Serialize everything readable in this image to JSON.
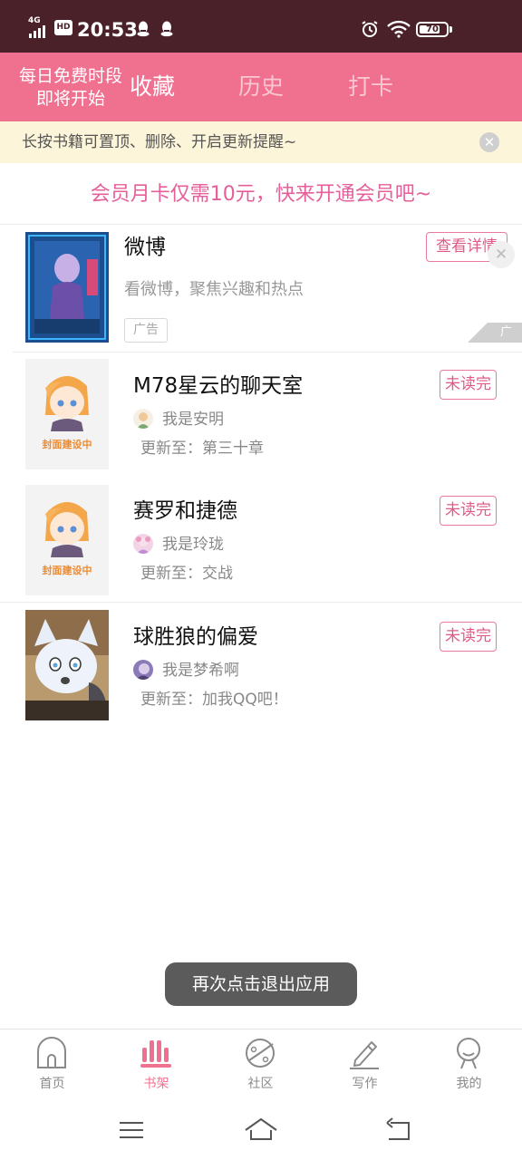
{
  "status_bar": {
    "network": "4G",
    "hd": "HD",
    "time": "20:53",
    "battery": "70"
  },
  "header": {
    "free_time_line1": "每日免费时段",
    "free_time_line2": "即将开始",
    "tabs": [
      {
        "label": "收藏",
        "active": true
      },
      {
        "label": "历史",
        "active": false
      },
      {
        "label": "打卡",
        "active": false
      }
    ]
  },
  "tip": {
    "text": "长按书籍可置顶、删除、开启更新提醒~"
  },
  "promo": {
    "text": "会员月卡仅需10元，快来开通会员吧~"
  },
  "ad": {
    "title": "微博",
    "description": "看微博，聚焦兴趣和热点",
    "button": "查看详情",
    "tag": "广告",
    "mark": "广告"
  },
  "books": [
    {
      "title": "M78星云的聊天室",
      "badge": "未读完",
      "author": "我是安明",
      "update": "更新至：第三十章",
      "cover_text": "封面建设中"
    },
    {
      "title": "赛罗和捷德",
      "badge": "未读完",
      "author": "我是玲珑",
      "update": "更新至：交战",
      "cover_text": "封面建设中"
    },
    {
      "title": "球胜狼的偏爱",
      "badge": "未读完",
      "author": "我是梦希啊",
      "update": "更新至：加我QQ吧！"
    }
  ],
  "toast": {
    "text": "再次点击退出应用"
  },
  "bottom_nav": [
    {
      "label": "首页",
      "icon": "home-icon"
    },
    {
      "label": "书架",
      "icon": "bookshelf-icon",
      "active": true
    },
    {
      "label": "社区",
      "icon": "planet-icon"
    },
    {
      "label": "写作",
      "icon": "pencil-icon"
    },
    {
      "label": "我的",
      "icon": "profile-icon"
    }
  ],
  "colors": {
    "status_bar": "#4a2129",
    "header": "#f07090",
    "accent": "#e05a86",
    "tip_bg": "#fdf5d9",
    "toast_bg": "#5b5b5b"
  }
}
